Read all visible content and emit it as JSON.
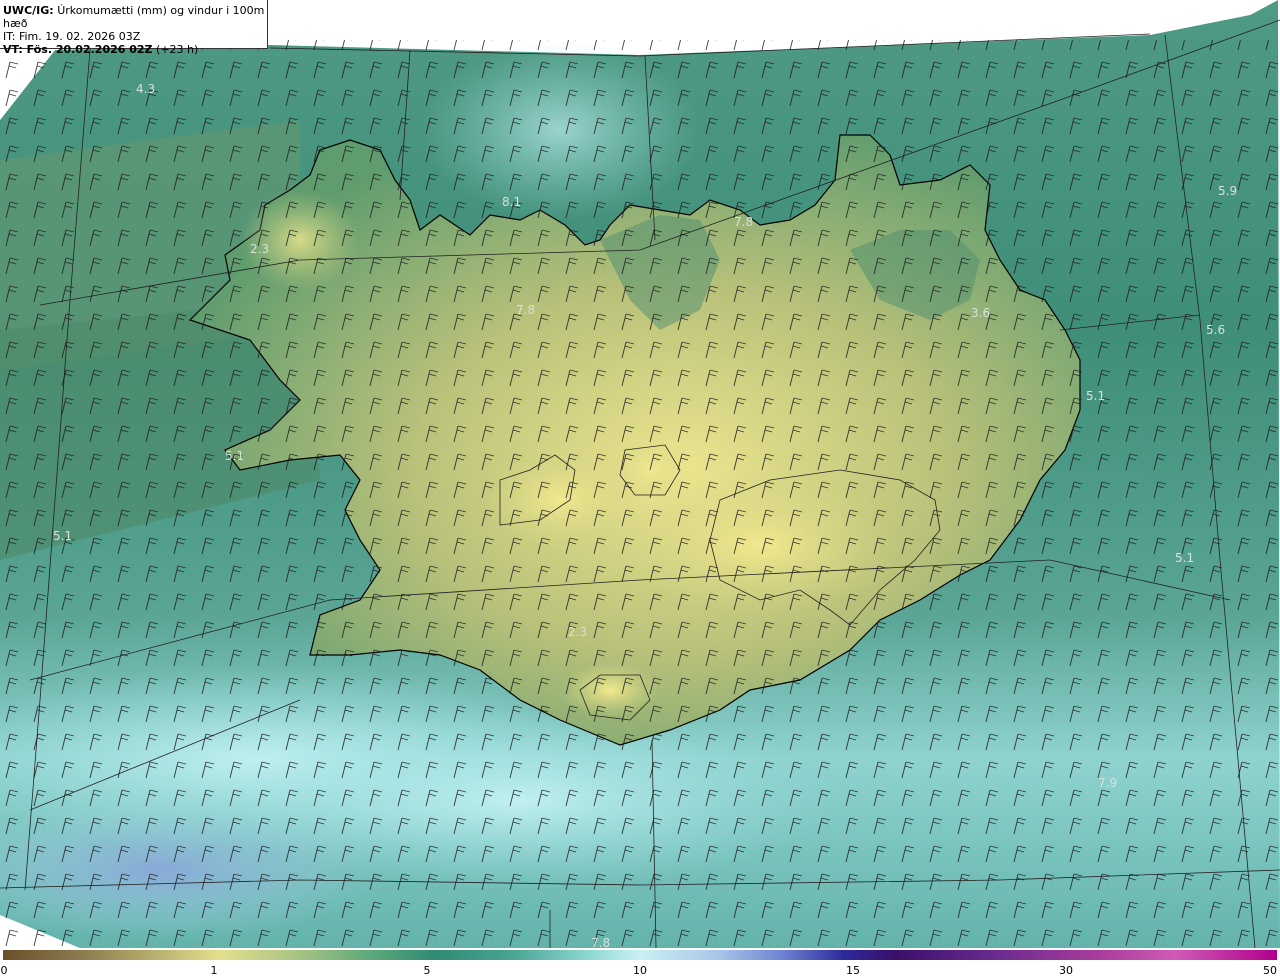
{
  "header": {
    "model_label": "UWC/IG:",
    "title": "Úrkomumætti (mm) og vindur i 100m hæð",
    "init_time": "IT: Fim. 19. 02. 2026 03Z",
    "valid_label": "VT: Fös. 20.02.2026 02Z",
    "valid_offset": "(+23 h)"
  },
  "colors": {
    "sea_green": "#3e8f78",
    "light_cyan": "#b9ecef",
    "land_yellow": "#e6e08a",
    "coast": "#000000",
    "grid": "#222222"
  },
  "map": {
    "value_labels": [
      "4.3",
      "8.1",
      "7.8",
      "3.6",
      "5.9",
      "5.6",
      "5.1",
      "5.1",
      "2.3",
      "7.8",
      "2.3",
      "5.1",
      "7.9",
      "5.1",
      "7.8"
    ]
  },
  "colorbar": {
    "ticks": [
      "0",
      "1",
      "5",
      "10",
      "15",
      "30",
      "50"
    ]
  }
}
